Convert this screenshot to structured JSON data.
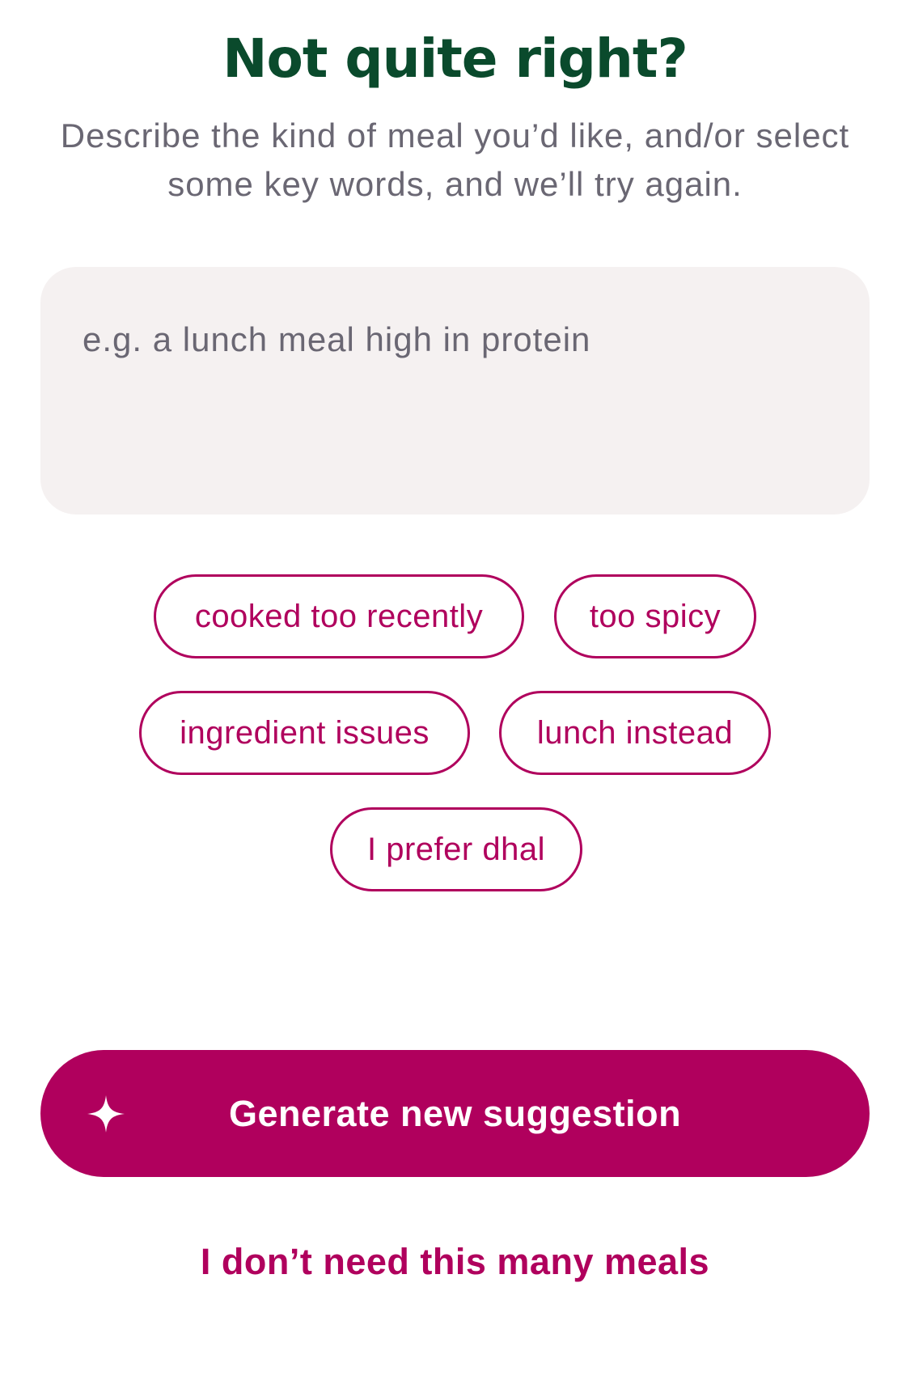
{
  "header": {
    "title": "Not quite right?",
    "subtitle": "Describe the kind of meal you’d like, and/or select some key words, and we’ll try again."
  },
  "input": {
    "value": "",
    "placeholder": "e.g. a lunch meal high in protein"
  },
  "keywords": [
    {
      "label": "cooked too recently",
      "selected": false
    },
    {
      "label": "too spicy",
      "selected": false
    },
    {
      "label": "ingredient issues",
      "selected": false
    },
    {
      "label": "lunch instead",
      "selected": false
    },
    {
      "label": "I prefer dhal",
      "selected": false
    }
  ],
  "actions": {
    "generate_label": "Generate new suggestion",
    "generate_icon": "sparkle-icon",
    "secondary_label": "I don’t need this many meals"
  },
  "colors": {
    "title": "#0a4a2c",
    "accent": "#b0005d",
    "input_background": "#f5f1f1",
    "muted_text": "#6a6773"
  }
}
